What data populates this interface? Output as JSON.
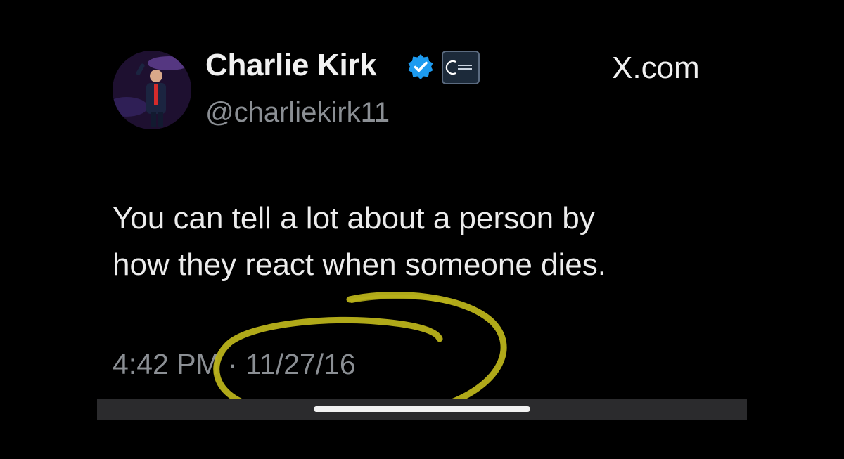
{
  "tweet": {
    "display_name": "Charlie Kirk",
    "handle": "@charliekirk11",
    "site": "X.com",
    "text_line1": "You can tell a lot about a person by",
    "text_line2": "how they react when someone dies.",
    "time": "4:42 PM",
    "separator": "·",
    "date": "11/27/16"
  },
  "badges": {
    "verified_icon": "verified-check-icon",
    "affiliate_icon": "organization-logo-icon"
  },
  "colors": {
    "background": "#000000",
    "verified_blue": "#1d9bf0",
    "annotation_yellow": "#b9b21a",
    "secondary_text": "#8b8f94"
  }
}
